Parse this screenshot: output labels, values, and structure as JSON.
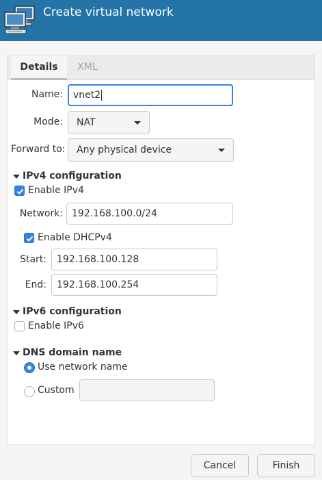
{
  "window": {
    "title": "Create virtual network",
    "icon": "network-computers-icon",
    "accent": "#2474a8"
  },
  "tabs": [
    {
      "label": "Details",
      "active": true
    },
    {
      "label": "XML",
      "active": false
    }
  ],
  "details": {
    "name_label": "Name:",
    "name_value": "vnet2",
    "mode_label": "Mode:",
    "mode_value": "NAT",
    "forward_label": "Forward to:",
    "forward_value": "Any physical device"
  },
  "ipv4": {
    "header": "IPv4 configuration",
    "enable_label": "Enable IPv4",
    "enabled": true,
    "network_label": "Network:",
    "network_value": "192.168.100.0/24",
    "dhcp_label": "Enable DHCPv4",
    "dhcp_enabled": true,
    "start_label": "Start:",
    "start_value": "192.168.100.128",
    "end_label": "End:",
    "end_value": "192.168.100.254"
  },
  "ipv6": {
    "header": "IPv6 configuration",
    "enable_label": "Enable IPv6",
    "enabled": false
  },
  "dns": {
    "header": "DNS domain name",
    "use_network_name_label": "Use network name",
    "custom_label": "Custom",
    "selected": "Use network name",
    "custom_value": ""
  },
  "footer": {
    "cancel_label": "Cancel",
    "finish_label": "Finish"
  }
}
